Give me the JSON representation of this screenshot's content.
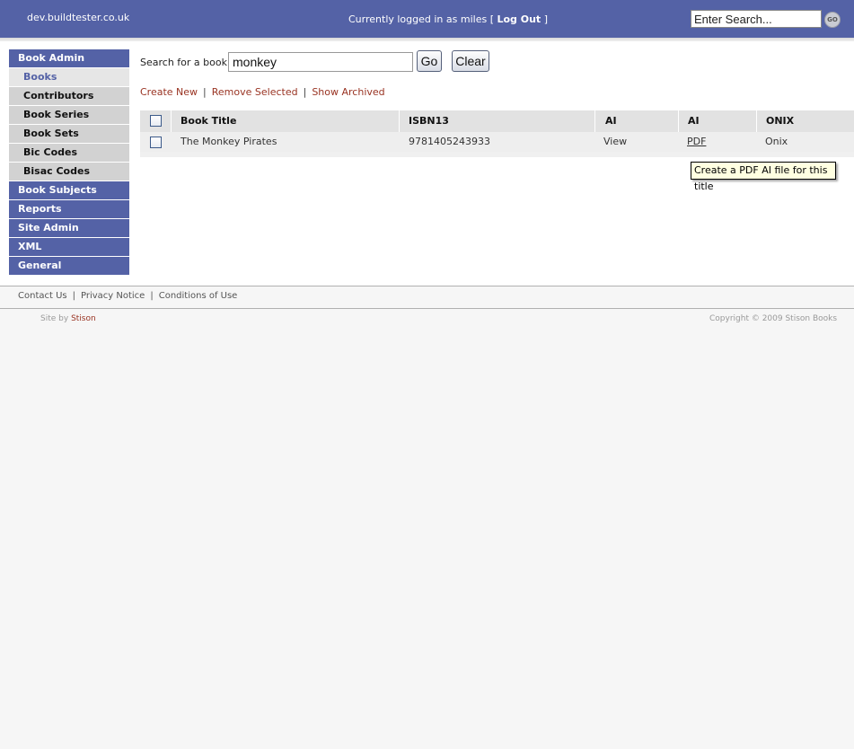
{
  "header": {
    "site_name": "dev.buildtester.co.uk",
    "login_text": "Currently logged in as miles [",
    "logout_label": "Log Out",
    "login_close": "]",
    "search_placeholder": "Enter Search...",
    "go_label": "GO"
  },
  "sidebar": {
    "items": [
      {
        "label": "Book Admin",
        "type": "main"
      },
      {
        "label": "Books",
        "type": "sub",
        "active": true
      },
      {
        "label": "Contributors",
        "type": "sub"
      },
      {
        "label": "Book Series",
        "type": "sub"
      },
      {
        "label": "Book Sets",
        "type": "sub"
      },
      {
        "label": "Bic Codes",
        "type": "sub"
      },
      {
        "label": "Bisac Codes",
        "type": "sub"
      },
      {
        "label": "Book Subjects",
        "type": "main"
      },
      {
        "label": "Reports",
        "type": "main"
      },
      {
        "label": "Site Admin",
        "type": "main"
      },
      {
        "label": "XML",
        "type": "main"
      },
      {
        "label": "General",
        "type": "main"
      }
    ]
  },
  "search": {
    "label": "Search for a book:",
    "value": "monkey",
    "go_label": "Go",
    "clear_label": "Clear"
  },
  "actions": {
    "create_new": "Create New",
    "remove_selected": "Remove Selected",
    "show_archived": "Show Archived",
    "separator": "|"
  },
  "table": {
    "headers": [
      "Book Title",
      "ISBN13",
      "AI",
      "AI",
      "ONIX"
    ],
    "rows": [
      {
        "title": "The Monkey Pirates",
        "isbn": "9781405243933",
        "ai_view": "View",
        "ai_pdf": "PDF",
        "onix": "Onix"
      }
    ]
  },
  "tooltip": "Create a PDF AI file for this title",
  "footer": {
    "links": [
      "Contact Us",
      "Privacy Notice",
      "Conditions of Use"
    ],
    "separator": "|",
    "site_by_prefix": "Site by",
    "site_by_name": "Stison",
    "copyright": "Copyright © 2009 Stison Books"
  },
  "colors": {
    "brand": "#5462a6",
    "link": "#993322"
  }
}
